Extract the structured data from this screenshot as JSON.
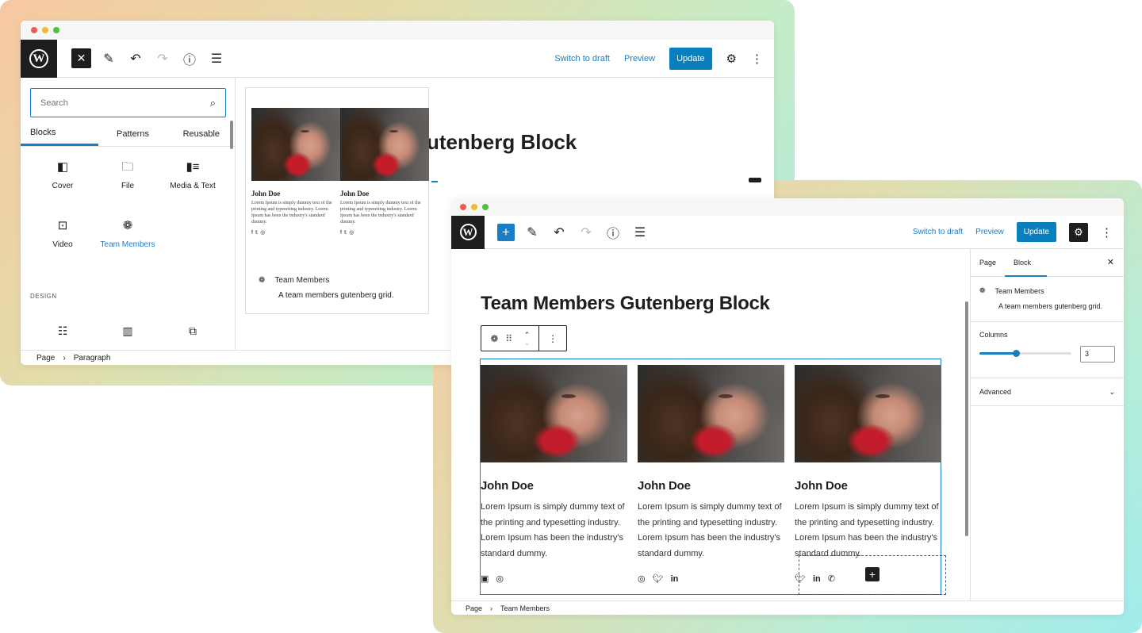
{
  "colors": {
    "accent": "#1a7ec4",
    "update_bg": "#0a7fbd",
    "dark": "#1e1e1e"
  },
  "window1": {
    "toolbar": {
      "switch_to_draft": "Switch to draft",
      "preview": "Preview",
      "update": "Update"
    },
    "inserter": {
      "search_placeholder": "Search",
      "tabs": [
        "Blocks",
        "Patterns",
        "Reusable"
      ],
      "blocks": [
        {
          "label": "Cover",
          "icon": "cover-icon"
        },
        {
          "label": "File",
          "icon": "folder-icon"
        },
        {
          "label": "Media & Text",
          "icon": "media-text-icon"
        },
        {
          "label": "Video",
          "icon": "video-icon"
        },
        {
          "label": "Team Members",
          "icon": "team-icon"
        }
      ],
      "design_heading": "DESIGN"
    },
    "canvas": {
      "title": "utenberg Block",
      "preview": {
        "members": [
          {
            "name": "John Doe",
            "text": "Lorem Ipsum is simply dummy text of the printing and typesetting industry. Lorem Ipsum has been the industry's standard dummy."
          },
          {
            "name": "John Doe",
            "text": "Lorem Ipsum is simply dummy text of the printing and typesetting industry. Lorem Ipsum has been the industry's standard dummy."
          }
        ],
        "block_name": "Team Members",
        "block_desc": "A team members gutenberg grid."
      }
    },
    "breadcrumb": [
      "Page",
      "Paragraph"
    ]
  },
  "window2": {
    "toolbar": {
      "switch_to_draft": "Switch to draft",
      "preview": "Preview",
      "update": "Update"
    },
    "canvas": {
      "title": "Team Members Gutenberg Block",
      "members": [
        {
          "name": "John Doe",
          "text": "Lorem Ipsum is simply dummy text of the printing and typesetting industry. Lorem Ipsum has been the industry's standard dummy.",
          "social": [
            "facebook-icon",
            "instagram-icon"
          ]
        },
        {
          "name": "John Doe",
          "text": "Lorem Ipsum is simply dummy text of the printing and typesetting industry. Lorem Ipsum has been the industry's standard dummy.",
          "social": [
            "instagram-icon",
            "twitter-icon",
            "linkedin-icon"
          ]
        },
        {
          "name": "John Doe",
          "text": "Lorem Ipsum is simply dummy text of the printing and typesetting industry. Lorem Ipsum has been the industry's standard dummy.",
          "social": [
            "twitter-icon",
            "linkedin-icon",
            "whatsapp-icon"
          ]
        }
      ]
    },
    "sidebar": {
      "tabs": [
        "Page",
        "Block"
      ],
      "block_name": "Team Members",
      "block_desc": "A team members gutenberg grid.",
      "columns_label": "Columns",
      "columns_value": "3",
      "columns_fraction": 0.4,
      "advanced_label": "Advanced"
    },
    "breadcrumb": [
      "Page",
      "Team Members"
    ]
  }
}
